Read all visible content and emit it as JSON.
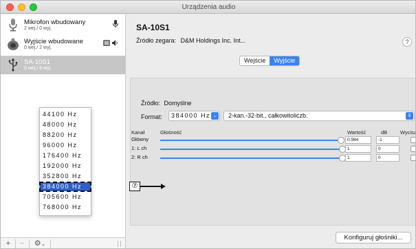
{
  "window": {
    "title": "Urządzenia audio"
  },
  "sidebar": {
    "devices": [
      {
        "name": "Mikrofon wbudowany",
        "sub": "2 wej./ 0 wyj.",
        "icon": "microphone-icon",
        "badge": "mic-glyph"
      },
      {
        "name": "Wyjście wbudowane",
        "sub": "0 wej./ 2 wyj.",
        "icon": "speaker-icon",
        "badge": "output-glyph"
      },
      {
        "name": "SA-10S1",
        "sub": "0 wej./ 8 wyj.",
        "icon": "usb-icon",
        "selected": true
      }
    ],
    "bottom": {
      "add": "+",
      "remove": "−",
      "gear": "⚙",
      "chevron": "⌄"
    }
  },
  "main": {
    "device_title": "SA-10S1",
    "clock_label": "Źródło zegara:",
    "clock_value": "D&M Holdings Inc. Int...",
    "help": "?",
    "tabs": [
      {
        "label": "Wejście",
        "active": false
      },
      {
        "label": "Wyjście",
        "active": true
      }
    ],
    "source_label": "Źródło:",
    "source_value": "Domyślne",
    "format_label": "Format:",
    "format_value": "384000 Hz",
    "channel_format": "2-kan.-32-bit., całkowitoliczb.",
    "table": {
      "headers": {
        "channel": "Kanał",
        "volume": "Głośność",
        "value": "Wartość",
        "db": "dB",
        "mute": "Wycisz"
      },
      "rows": [
        {
          "label": "Główny",
          "value": "0.984",
          "db": "-1"
        },
        {
          "label": "1: L ch",
          "value": "1",
          "db": "0"
        },
        {
          "label": "2: R ch",
          "value": "1",
          "db": "0"
        }
      ]
    },
    "dropdown": {
      "options": [
        "44100 Hz",
        "48000 Hz",
        "88200 Hz",
        "96000 Hz",
        "176400 Hz",
        "192000 Hz",
        "352800 Hz",
        "384000 Hz",
        "705600 Hz",
        "768000 Hz"
      ],
      "highlighted_index": 7
    },
    "callout": "⑦",
    "configure_button": "Konfiguruj głośniki..."
  },
  "colors": {
    "accent": "#3a82f7",
    "highlight": "#2d5fc7",
    "close": "#fc5f57",
    "minimize": "#fdbc2e",
    "zoom": "#27c840"
  }
}
